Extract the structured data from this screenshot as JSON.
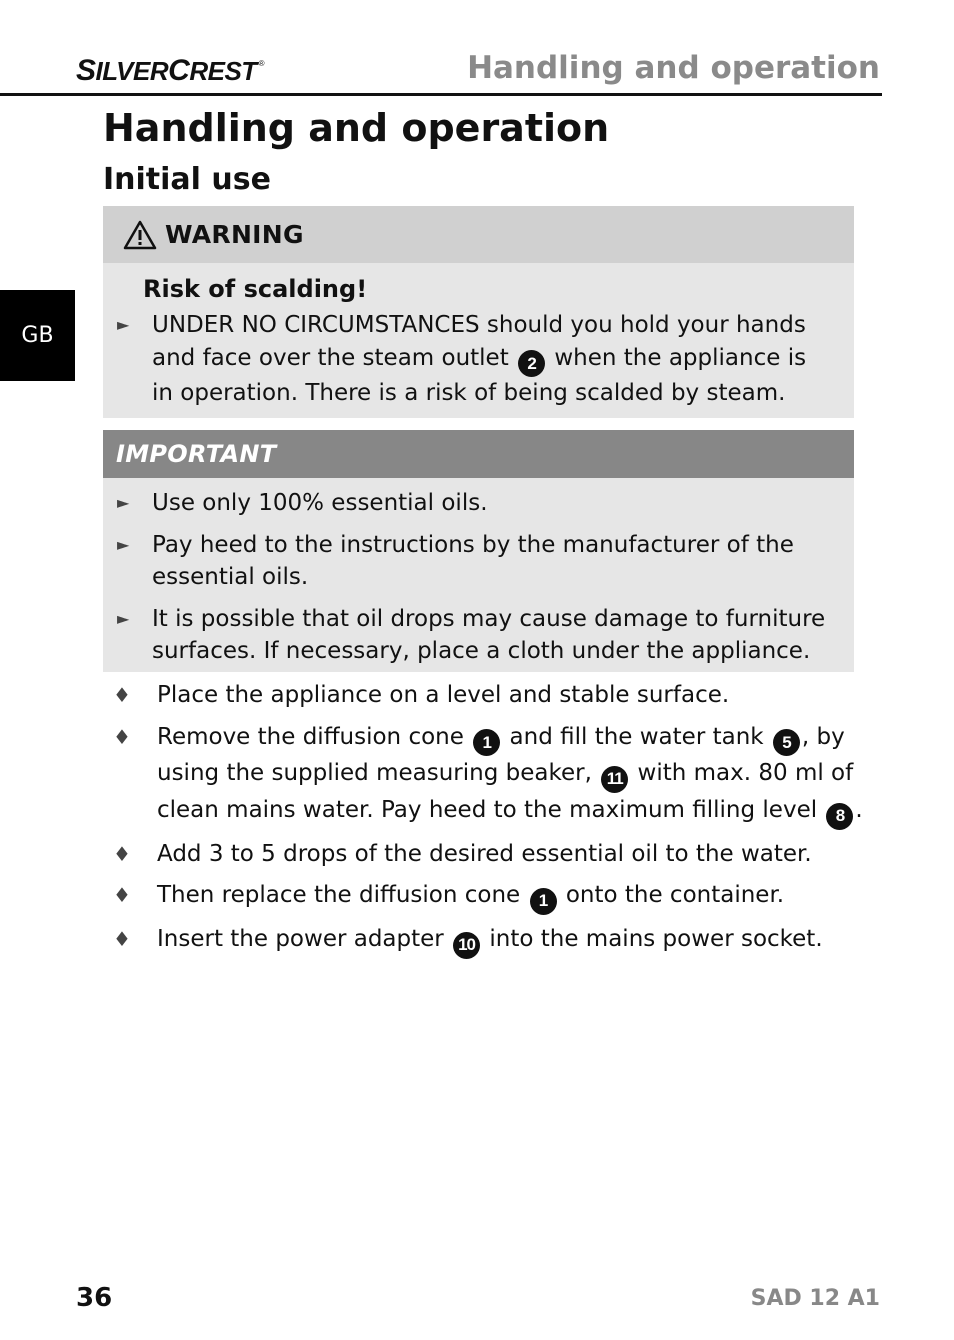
{
  "header": {
    "brand_first": "S",
    "brand_rest1": "ILVER",
    "brand_second": "C",
    "brand_rest2": "REST",
    "brand_mark": "®",
    "section": "Handling and operation"
  },
  "language_tab": "GB",
  "page_title": "Handling and operation",
  "section_title": "Initial use",
  "warning": {
    "icon": "warning-triangle-icon",
    "label": "WARNING",
    "subtitle": "Risk of scalding!",
    "items": [
      {
        "before": "UNDER NO CIRCUMSTANCES should you hold your hands and face over the steam outlet ",
        "ref": "2",
        "after": " when the appliance is in operation. There is a risk of being scalded by steam."
      }
    ]
  },
  "important": {
    "label": "IMPORTANT",
    "items": [
      "Use only 100% essential oils.",
      "Pay heed to the instructions by the manufacturer of the essential oils.",
      "It is possible that oil drops may cause damage to furniture surfaces. If necessary, place a cloth under the appliance."
    ]
  },
  "bullet_glyphs": {
    "arrow": "►",
    "diamond": "♦"
  },
  "steps": [
    {
      "t1": "Place the appliance on a level and stable surface."
    },
    {
      "t1": "Remove the diffusion cone ",
      "r1": "1",
      "t2": " and fill the water tank ",
      "r2": "5",
      "t3": ", by using the supplied measuring beaker, ",
      "r3": "11",
      "t4": " with max. 80 ml of clean mains water. Pay heed to the maximum filling level ",
      "r4": "8",
      "t5": "."
    },
    {
      "t1": "Add 3 to 5 drops of the desired essential oil to the water."
    },
    {
      "t1": "Then replace the diffusion cone ",
      "r1": "1",
      "t2": " onto the container."
    },
    {
      "t1": "Insert the power adapter ",
      "r1": "10",
      "t2": " into the mains power socket."
    }
  ],
  "footer": {
    "page_number": "36",
    "model": "SAD 12 A1"
  }
}
